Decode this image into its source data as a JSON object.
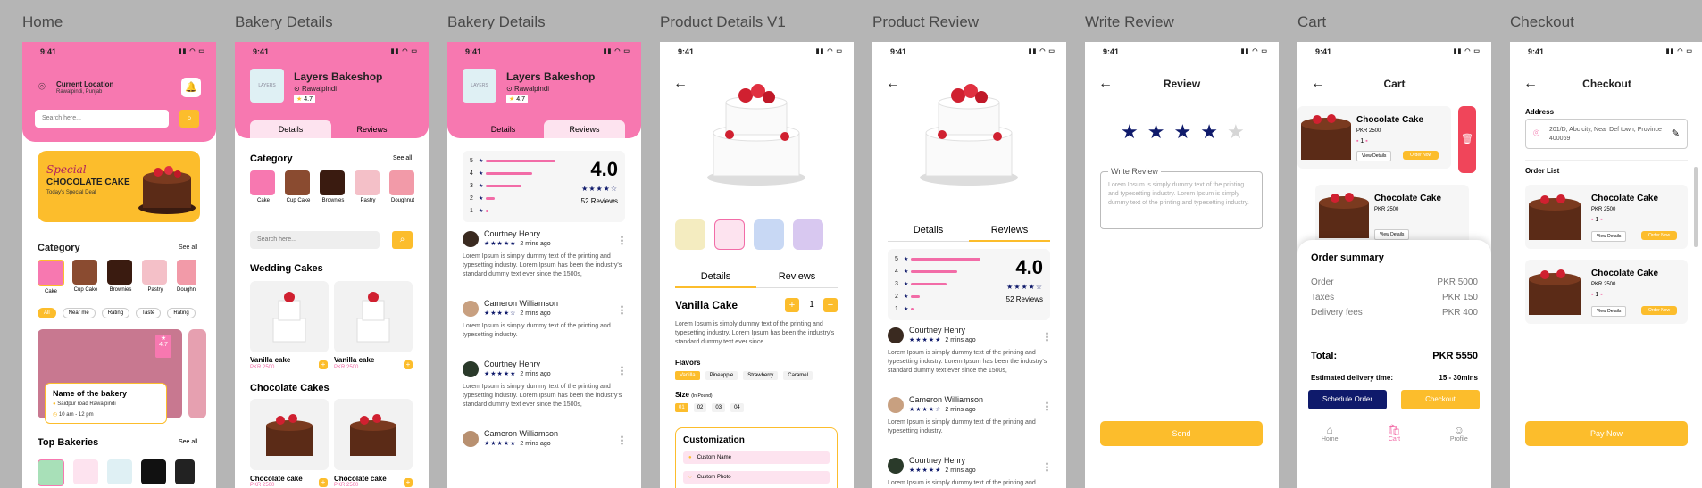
{
  "frames": {
    "home": "Home",
    "bakery1": "Bakery Details",
    "bakery2": "Bakery Details",
    "product": "Product Details V1",
    "review": "Product Review",
    "write": "Write Review",
    "cart": "Cart",
    "checkout": "Checkout"
  },
  "status_time": "9:41",
  "home": {
    "location_label": "Current Location",
    "location_value": "Rawalpindi, Punjab",
    "search_placeholder": "Search here...",
    "banner_special": "Special",
    "banner_title": "CHOCOLATE CAKE",
    "banner_sub": "Today's Special Deal",
    "category_title": "Category",
    "see_all": "See all",
    "categories": [
      "Cake",
      "Cup Cake",
      "Brownies",
      "Pastry",
      "Doughn"
    ],
    "filters": [
      "All",
      "Near me",
      "Rating",
      "Taste",
      "Rating"
    ],
    "bakery_name": "Name of the bakery",
    "bakery_address": "Saidpur road Rawalpindi",
    "bakery_hours": "10 am - 12 pm",
    "bakery_rating": "4.7",
    "top_title": "Top Bakeries"
  },
  "bakery": {
    "name": "Layers Bakeshop",
    "city": "Rawalpindi",
    "rating": "4.7",
    "logo": "LAYERS",
    "tab_details": "Details",
    "tab_reviews": "Reviews",
    "category_title": "Category",
    "see_all": "See all",
    "categories": [
      "Cake",
      "Cup Cake",
      "Brownies",
      "Pastry",
      "Doughnut"
    ],
    "search_placeholder": "Search here...",
    "wedding_title": "Wedding Cakes",
    "chocolate_title": "Chocolate Cakes",
    "wedding_items": [
      {
        "name": "Vanilla cake",
        "price": "PKR 2500"
      },
      {
        "name": "Vanilla cake",
        "price": "PKR 2500"
      }
    ],
    "choc_items": [
      {
        "name": "Chocolate cake",
        "price": "PKR 2500"
      },
      {
        "name": "Chocolate cake",
        "price": "PKR 2500"
      }
    ]
  },
  "ratings": {
    "score": "4.0",
    "count": "52 Reviews",
    "levels": [
      "5",
      "4",
      "3",
      "2",
      "1"
    ],
    "level_share": [
      0.82,
      0.55,
      0.42,
      0.1,
      0.03
    ],
    "stars": "★★★★☆"
  },
  "reviews": [
    {
      "name": "Courtney Henry",
      "time": "2 mins ago",
      "stars": "★★★★★",
      "text": "Lorem Ipsum is simply dummy text of the printing and typesetting industry. Lorem Ipsum has been the industry's standard dummy text ever since the 1500s,"
    },
    {
      "name": "Cameron Williamson",
      "time": "2 mins ago",
      "stars": "★★★★☆",
      "text": "Lorem Ipsum is simply dummy text of the printing and typesetting industry."
    },
    {
      "name": "Courtney Henry",
      "time": "2 mins ago",
      "stars": "★★★★★",
      "text": "Lorem Ipsum is simply dummy text of the printing and typesetting industry. Lorem Ipsum has been the industry's standard dummy text ever since the 1500s,"
    },
    {
      "name": "Cameron Williamson",
      "time": "2 mins ago",
      "stars": "★★★★★",
      "text": ""
    }
  ],
  "product": {
    "tab_details": "Details",
    "tab_reviews": "Reviews",
    "name": "Vanilla Cake",
    "qty": "1",
    "desc": "Lorem Ipsum is simply dummy text of the printing and typesetting industry. Lorem Ipsum has been the industry's standard dummy text ever since ...",
    "flavors_label": "Flavors",
    "flavors": [
      "Vanilla",
      "Pineapple",
      "Strawberry",
      "Caramel"
    ],
    "size_label": "Size",
    "size_unit": "(In Pound)",
    "sizes": [
      "01",
      "02",
      "03",
      "04"
    ],
    "custom_title": "Customization",
    "custom_name": "Custom Name",
    "custom_photo": "Custom Photo"
  },
  "write": {
    "title": "Review",
    "label": "Write Review",
    "placeholder": "Lorem Ipsum is simply dummy text of the printing and typesetting industry. Lorem Ipsum is simply dummy text of the printing and typesetting industry.",
    "send": "Send",
    "rating_stars": 4
  },
  "cart": {
    "title": "Cart",
    "items": [
      {
        "name": "Chocolate Cake",
        "price": "PKR 2500"
      },
      {
        "name": "Chocolate Cake",
        "price": "PKR 2500"
      }
    ],
    "view_details": "View Details",
    "order_now": "Order Now",
    "summary_title": "Order summary",
    "rows": [
      {
        "label": "Order",
        "value": "PKR 5000"
      },
      {
        "label": "Taxes",
        "value": "PKR 150"
      },
      {
        "label": "Delivery fees",
        "value": "PKR 400"
      }
    ],
    "total_label": "Total:",
    "total_value": "PKR 5550",
    "est_label": "Estimated delivery time:",
    "est_value": "15 - 30mins",
    "schedule": "Schedule Order",
    "checkout": "Checkout",
    "nav": [
      "Home",
      "Cart",
      "Profile"
    ]
  },
  "checkout": {
    "title": "Checkout",
    "address_label": "Address",
    "address_value": "201/D, Abc city, Near Def town, Province 400069",
    "order_list": "Order List",
    "items": [
      {
        "name": "Chocolate Cake",
        "price": "PKR 2500"
      },
      {
        "name": "Chocolate Cake",
        "price": "PKR 2500"
      }
    ],
    "view_details": "View Details",
    "order_now": "Order Now",
    "pay": "Pay Now"
  },
  "colors": {
    "pink": "#f778b0",
    "yellow": "#fcbd2c",
    "navy": "#0f1a6b"
  }
}
